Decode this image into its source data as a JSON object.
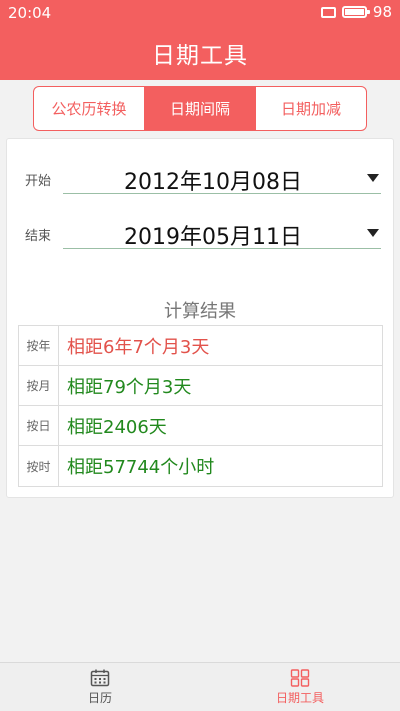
{
  "status": {
    "time": "20:04",
    "battery": "98",
    "battery_level": 0.98
  },
  "app": {
    "title": "日期工具"
  },
  "tabs": [
    {
      "label": "公农历转换",
      "active": false
    },
    {
      "label": "日期间隔",
      "active": true
    },
    {
      "label": "日期加减",
      "active": false
    }
  ],
  "form": {
    "start_label": "开始",
    "start_value": "2012年10月08日",
    "end_label": "结束",
    "end_value": "2019年05月11日"
  },
  "result": {
    "title": "计算结果",
    "rows": [
      {
        "label": "按年",
        "value": "相距6年7个月3天",
        "color": "#e2524b"
      },
      {
        "label": "按月",
        "value": "相距79个月3天",
        "color": "#22891e"
      },
      {
        "label": "按日",
        "value": "相距2406天",
        "color": "#22891e"
      },
      {
        "label": "按时",
        "value": "相距57744个小时",
        "color": "#22891e"
      }
    ]
  },
  "bottom_nav": [
    {
      "label": "日历",
      "icon": "calendar-icon",
      "active": false
    },
    {
      "label": "日期工具",
      "icon": "grid-icon",
      "active": true
    }
  ],
  "colors": {
    "accent": "#f35f5f",
    "inactive": "#555555"
  }
}
